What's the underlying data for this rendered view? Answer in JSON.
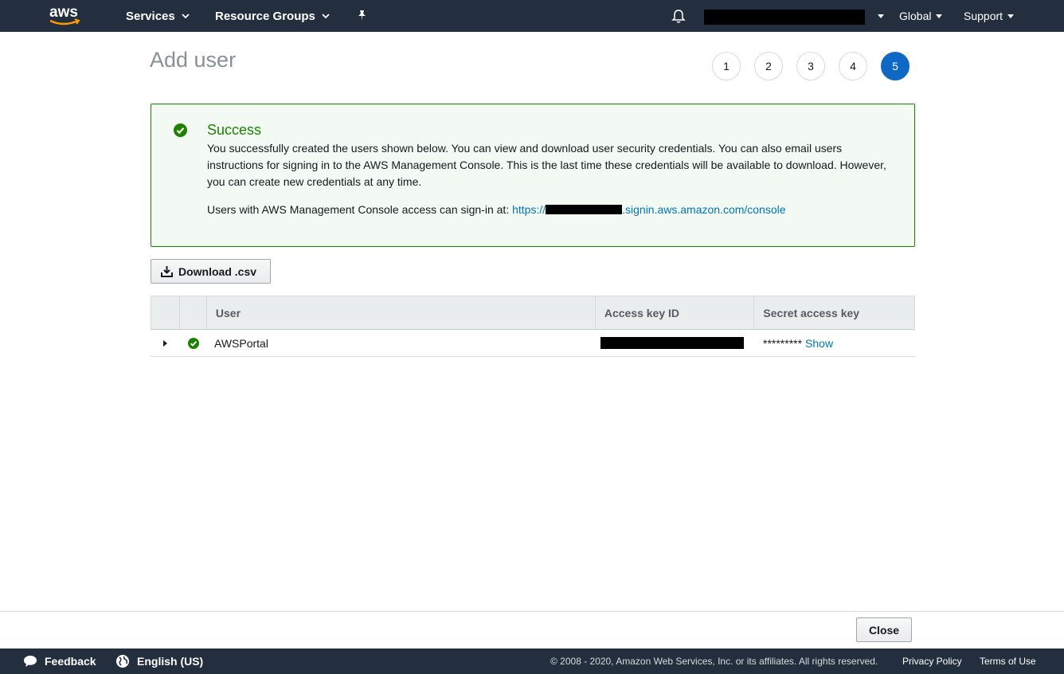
{
  "nav": {
    "logo_text": "aws",
    "services": "Services",
    "resource_groups": "Resource Groups",
    "region": "Global",
    "support": "Support"
  },
  "page": {
    "title": "Add user",
    "steps": [
      "1",
      "2",
      "3",
      "4",
      "5"
    ],
    "active_step": "5"
  },
  "alert": {
    "title": "Success",
    "body": "You successfully created the users shown below. You can view and download user security credentials. You can also email users instructions for signing in to the AWS Management Console. This is the last time these credentials will be available to download. However, you can create new credentials at any time.",
    "signin_prefix": "Users with AWS Management Console access can sign-in at:",
    "signin_url_start": "https://",
    "signin_url_end": ".signin.aws.amazon.com/console"
  },
  "download_button": "Download .csv",
  "table": {
    "headers": [
      "User",
      "Access key ID",
      "Secret access key"
    ],
    "rows": [
      {
        "user": "AWSPortal",
        "secret_mask": "*********",
        "show_link": "Show"
      }
    ]
  },
  "close_button": "Close",
  "footer": {
    "feedback": "Feedback",
    "language": "English (US)",
    "copyright": "© 2008 - 2020, Amazon Web Services, Inc. or its affiliates. All rights reserved.",
    "privacy": "Privacy Policy",
    "terms": "Terms of Use"
  },
  "colors": {
    "nav_bg": "#232f3e",
    "success_green": "#1d8102",
    "link_blue": "#0073bb",
    "step_active": "#0f68c4"
  }
}
